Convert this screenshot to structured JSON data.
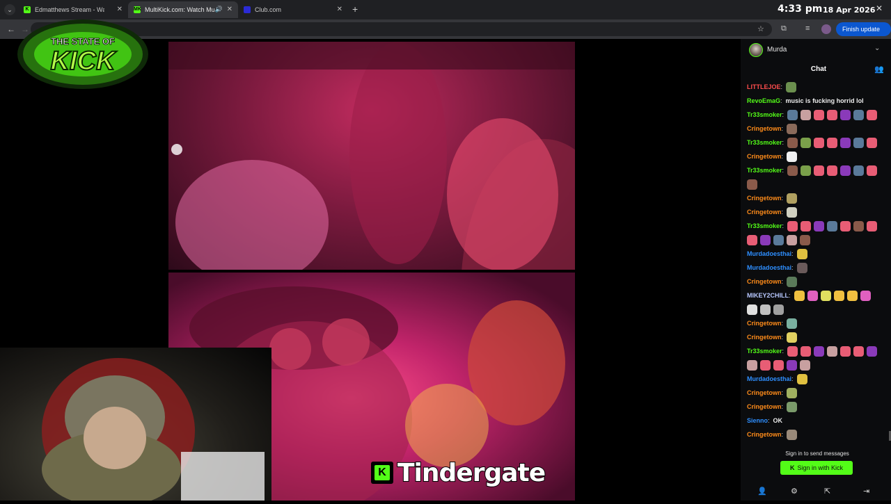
{
  "browser": {
    "tabs": [
      {
        "title": "Edmatthews Stream - Watch Li",
        "favicon": "K",
        "favicon_color": "#53fc18"
      },
      {
        "title": "MultiKick.com: Watch Multi",
        "favicon": "MK",
        "favicon_color": "#53fc18"
      },
      {
        "title": "Club.com",
        "favicon": "",
        "favicon_color": "#2b2bd6"
      }
    ],
    "time": "4:33 pm",
    "date": "18 Apr 2026",
    "finish_update": "Finish update"
  },
  "stream": {
    "logo_text": "THE STATE OF KICK",
    "caption": "Tindergate"
  },
  "chat": {
    "streamer": "Murda",
    "title": "Chat",
    "messages": [
      {
        "user": "LITTLEJOE",
        "color": "#ff4d4d",
        "text": "",
        "emotes": [
          "#6b8f4e"
        ]
      },
      {
        "user": "RevoEmaG",
        "color": "#53fc18",
        "text": "music is fucking horrid lol",
        "emotes": []
      },
      {
        "user": "Tr33smoker",
        "color": "#53fc18",
        "text": "",
        "emotes": [
          "#5a7a9a",
          "#c8a0a0",
          "#e85d75",
          "#e85d75",
          "#8a3ab9",
          "#5a7a9a",
          "#e85d75"
        ]
      },
      {
        "user": "Cringetown",
        "color": "#ff8c1a",
        "text": "",
        "emotes": [
          "#8a6a5a"
        ]
      },
      {
        "user": "Tr33smoker",
        "color": "#53fc18",
        "text": "",
        "emotes": [
          "#8a5a4a",
          "#7aa04a",
          "#e85d75",
          "#e85d75",
          "#8a3ab9",
          "#5a7a9a",
          "#e85d75"
        ]
      },
      {
        "user": "Cringetown",
        "color": "#ff8c1a",
        "text": "",
        "emotes": [
          "#f0f0f0"
        ]
      },
      {
        "user": "Tr33smoker",
        "color": "#53fc18",
        "text": "",
        "emotes": [
          "#8a5a4a",
          "#7aa04a",
          "#e85d75",
          "#e85d75",
          "#8a3ab9",
          "#5a7a9a",
          "#e85d75"
        ]
      },
      {
        "user": "",
        "color": "#ffffff",
        "text": "",
        "emotes": [
          "#8a5a4a"
        ]
      },
      {
        "user": "Cringetown",
        "color": "#ff8c1a",
        "text": "",
        "emotes": [
          "#b0a060"
        ]
      },
      {
        "user": "Cringetown",
        "color": "#ff8c1a",
        "text": "",
        "emotes": [
          "#d0d0c0"
        ]
      },
      {
        "user": "Tr33smoker",
        "color": "#53fc18",
        "text": "",
        "emotes": [
          "#e85d75",
          "#e85d75",
          "#8a3ab9",
          "#5a7a9a",
          "#e85d75",
          "#8a5a4a",
          "#e85d75"
        ]
      },
      {
        "user": "",
        "color": "#ffffff",
        "text": "",
        "emotes": [
          "#e85d75",
          "#8a3ab9",
          "#5a7a9a",
          "#c8a0a0",
          "#8a5a4a"
        ]
      },
      {
        "user": "Murdadoesthai",
        "color": "#2e8fff",
        "text": "",
        "emotes": [
          "#e0c040"
        ]
      },
      {
        "user": "Murdadoesthai",
        "color": "#2e8fff",
        "text": "",
        "emotes": [
          "#6a5a5a"
        ]
      },
      {
        "user": "Cringetown",
        "color": "#ff8c1a",
        "text": "",
        "emotes": [
          "#5a7a5a"
        ]
      },
      {
        "user": "MIKEY2CHILL",
        "color": "#b8c8ff",
        "text": "",
        "emotes": [
          "#f0c040",
          "#e060c0",
          "#e0e060",
          "#f0c040",
          "#f0c040",
          "#e060c0"
        ]
      },
      {
        "user": "",
        "color": "#ffffff",
        "text": "",
        "emotes": [
          "#e0e0e0",
          "#c0c0c0",
          "#a0a0a0"
        ]
      },
      {
        "user": "Cringetown",
        "color": "#ff8c1a",
        "text": "",
        "emotes": [
          "#7ab0a0"
        ]
      },
      {
        "user": "Cringetown",
        "color": "#ff8c1a",
        "text": "",
        "emotes": [
          "#e0d060"
        ]
      },
      {
        "user": "Tr33smoker",
        "color": "#53fc18",
        "text": "",
        "emotes": [
          "#e85d75",
          "#e85d75",
          "#8a3ab9",
          "#c8a0a0",
          "#e85d75",
          "#e85d75",
          "#8a3ab9"
        ]
      },
      {
        "user": "",
        "color": "#ffffff",
        "text": "",
        "emotes": [
          "#c8a0a0",
          "#e85d75",
          "#e85d75",
          "#8a3ab9",
          "#c8a0a0"
        ]
      },
      {
        "user": "Murdadoesthai",
        "color": "#2e8fff",
        "text": "",
        "emotes": [
          "#e0c040"
        ]
      },
      {
        "user": "Cringetown",
        "color": "#ff8c1a",
        "text": "",
        "emotes": [
          "#a0b060"
        ]
      },
      {
        "user": "Cringetown",
        "color": "#ff8c1a",
        "text": "",
        "emotes": [
          "#7a9a6a"
        ]
      },
      {
        "user": "Sienno",
        "color": "#2e8fff",
        "text": "OK",
        "emotes": []
      },
      {
        "user": "Cringetown",
        "color": "#ff8c1a",
        "text": "",
        "emotes": [
          "#9a8a7a"
        ]
      }
    ],
    "signin_hint": "Sign in to send messages",
    "signin_button": "Sign in with Kick"
  }
}
